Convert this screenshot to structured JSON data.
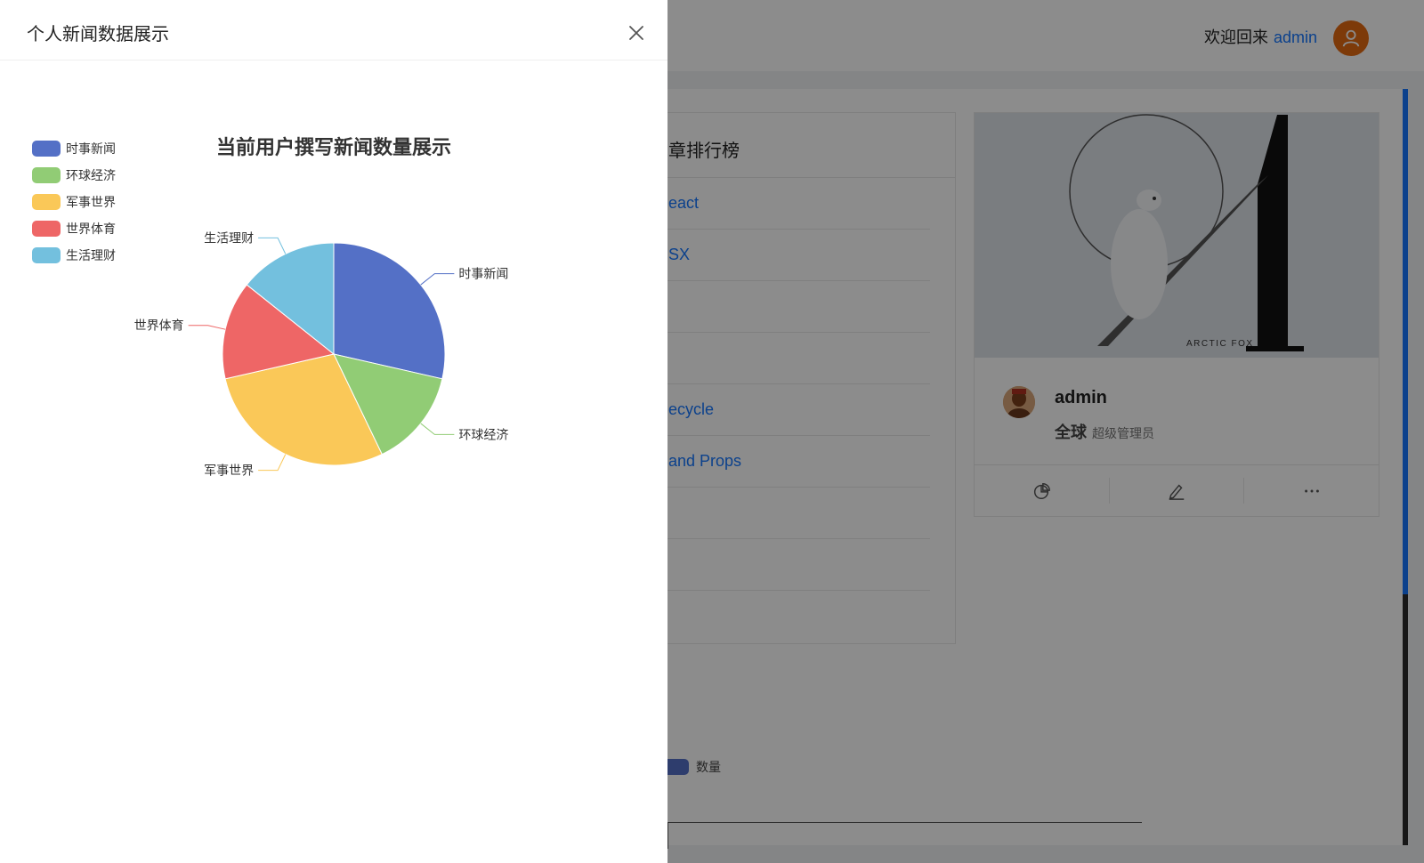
{
  "header": {
    "welcome_prefix": "欢迎回来",
    "username": "admin"
  },
  "rank_card": {
    "title": "章排行榜",
    "items": [
      "eact",
      "SX",
      "",
      "",
      "ecycle",
      " and Props",
      "",
      ""
    ]
  },
  "profile_card": {
    "cover_text": "ARCTIC FOX",
    "name": "admin",
    "region": "全球",
    "role": "超级管理员",
    "action_icons": [
      "pie-chart-icon",
      "edit-icon",
      "more-icon"
    ]
  },
  "bar_chart": {
    "legend_label": "数量",
    "color": "#5470c6"
  },
  "drawer": {
    "title": "个人新闻数据展示",
    "close_icon": "close-icon"
  },
  "chart_data": {
    "type": "pie",
    "title": "当前用户撰写新闻数量展示",
    "legend_position": "top-left",
    "slices": [
      {
        "name": "时事新闻",
        "value": 3,
        "color": "#5470c6"
      },
      {
        "name": "环球经济",
        "value": 1.5,
        "color": "#91cc75"
      },
      {
        "name": "军事世界",
        "value": 3,
        "color": "#fac858"
      },
      {
        "name": "世界体育",
        "value": 1.5,
        "color": "#ee6666"
      },
      {
        "name": "生活理财",
        "value": 1.5,
        "color": "#73c0de"
      }
    ]
  }
}
